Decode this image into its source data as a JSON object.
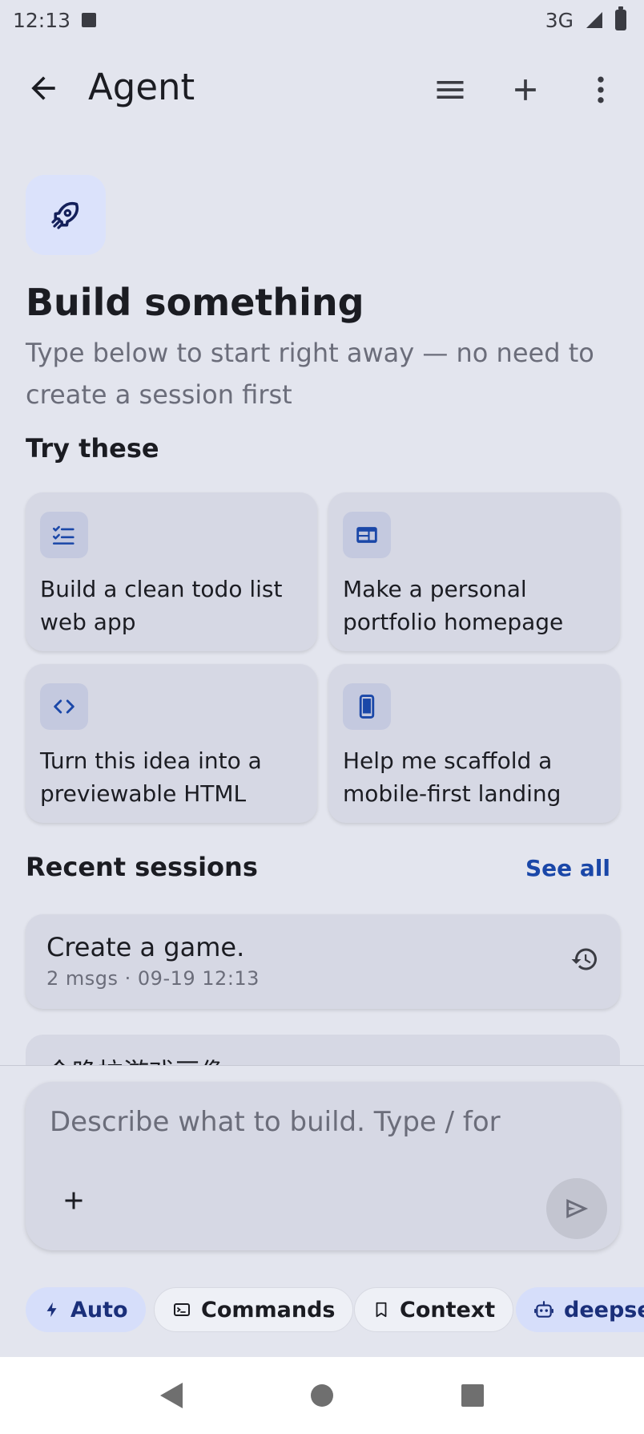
{
  "status_bar": {
    "time": "12:13",
    "network": "3G"
  },
  "app_bar": {
    "title": "Agent"
  },
  "hero": {
    "title": "Build something",
    "subtitle": "Type below to start right away — no need to create a session first"
  },
  "suggestions": {
    "heading": "Try these",
    "items": [
      {
        "label": "Build a clean todo list web app",
        "icon": "checklist-icon"
      },
      {
        "label": "Make a personal portfolio homepage",
        "icon": "web-layout-icon"
      },
      {
        "label": "Turn this idea into a previewable HTML",
        "icon": "code-icon"
      },
      {
        "label": "Help me scaffold a mobile-first landing",
        "icon": "smartphone-icon"
      }
    ]
  },
  "recent": {
    "heading": "Recent sessions",
    "see_all": "See all",
    "sessions": [
      {
        "title": "Create a game.",
        "meta": "2 msgs · 09-19 12:13"
      },
      {
        "title": "今晚拉游戏画像"
      }
    ]
  },
  "composer": {
    "placeholder": "Describe what to build. Type / for"
  },
  "chips": [
    {
      "label": "Auto",
      "icon": "bolt-icon"
    },
    {
      "label": "Commands",
      "icon": "terminal-icon"
    },
    {
      "label": "Context",
      "icon": "bookmark-icon"
    },
    {
      "label": "deepseek",
      "icon": "robot-icon"
    }
  ],
  "colors": {
    "accent": "#1a47a8",
    "background": "#e3e5ee",
    "card": "#d6d8e4"
  }
}
